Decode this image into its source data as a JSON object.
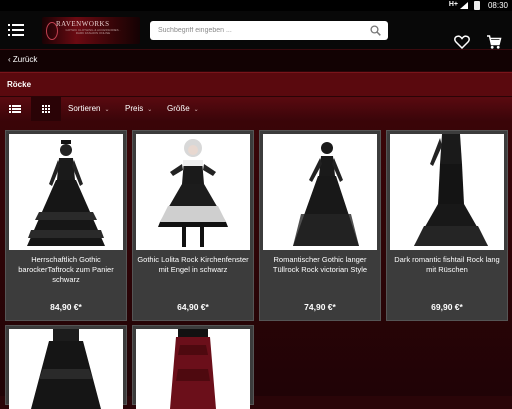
{
  "status_bar": {
    "network": "H+",
    "time": "08:30"
  },
  "header": {
    "logo": {
      "brand": "RAVENWORKS",
      "tagline": "GOTHIC CLOTHING & ACCESSORIES · DARK FASHION ONLINE"
    },
    "search": {
      "placeholder": "Suchbegriff eingeben ..."
    },
    "icons": [
      "menu-icon",
      "search-icon",
      "heart-icon",
      "cart-icon"
    ]
  },
  "nav": {
    "back_label": "‹ Zurück"
  },
  "category": {
    "title": "Röcke"
  },
  "filters": {
    "view_modes": [
      "list-view-icon",
      "grid-view-icon"
    ],
    "active_view": "grid",
    "items": [
      {
        "label": "Sortieren"
      },
      {
        "label": "Preis"
      },
      {
        "label": "Größe"
      }
    ]
  },
  "products": [
    {
      "name": "Herrschaftlich Gothic barockerTaftrock zum Panier schwarz",
      "price": "84,90 €*"
    },
    {
      "name": "Gothic Lolita Rock Kirchenfenster mit Engel in schwarz",
      "price": "64,90 €*"
    },
    {
      "name": "Romantischer Gothic langer Tüllrock Rock victorian Style",
      "price": "74,90 €*"
    },
    {
      "name": "Dark romantic fishtail Rock lang mit Rüschen",
      "price": "69,90 €*"
    },
    {
      "name": "",
      "price": ""
    },
    {
      "name": "",
      "price": ""
    }
  ],
  "colors": {
    "page_bg": "#2a0508",
    "category_bar": "#5a090e",
    "card_bg": "#3c3c3c",
    "header_bg": "#080808"
  }
}
